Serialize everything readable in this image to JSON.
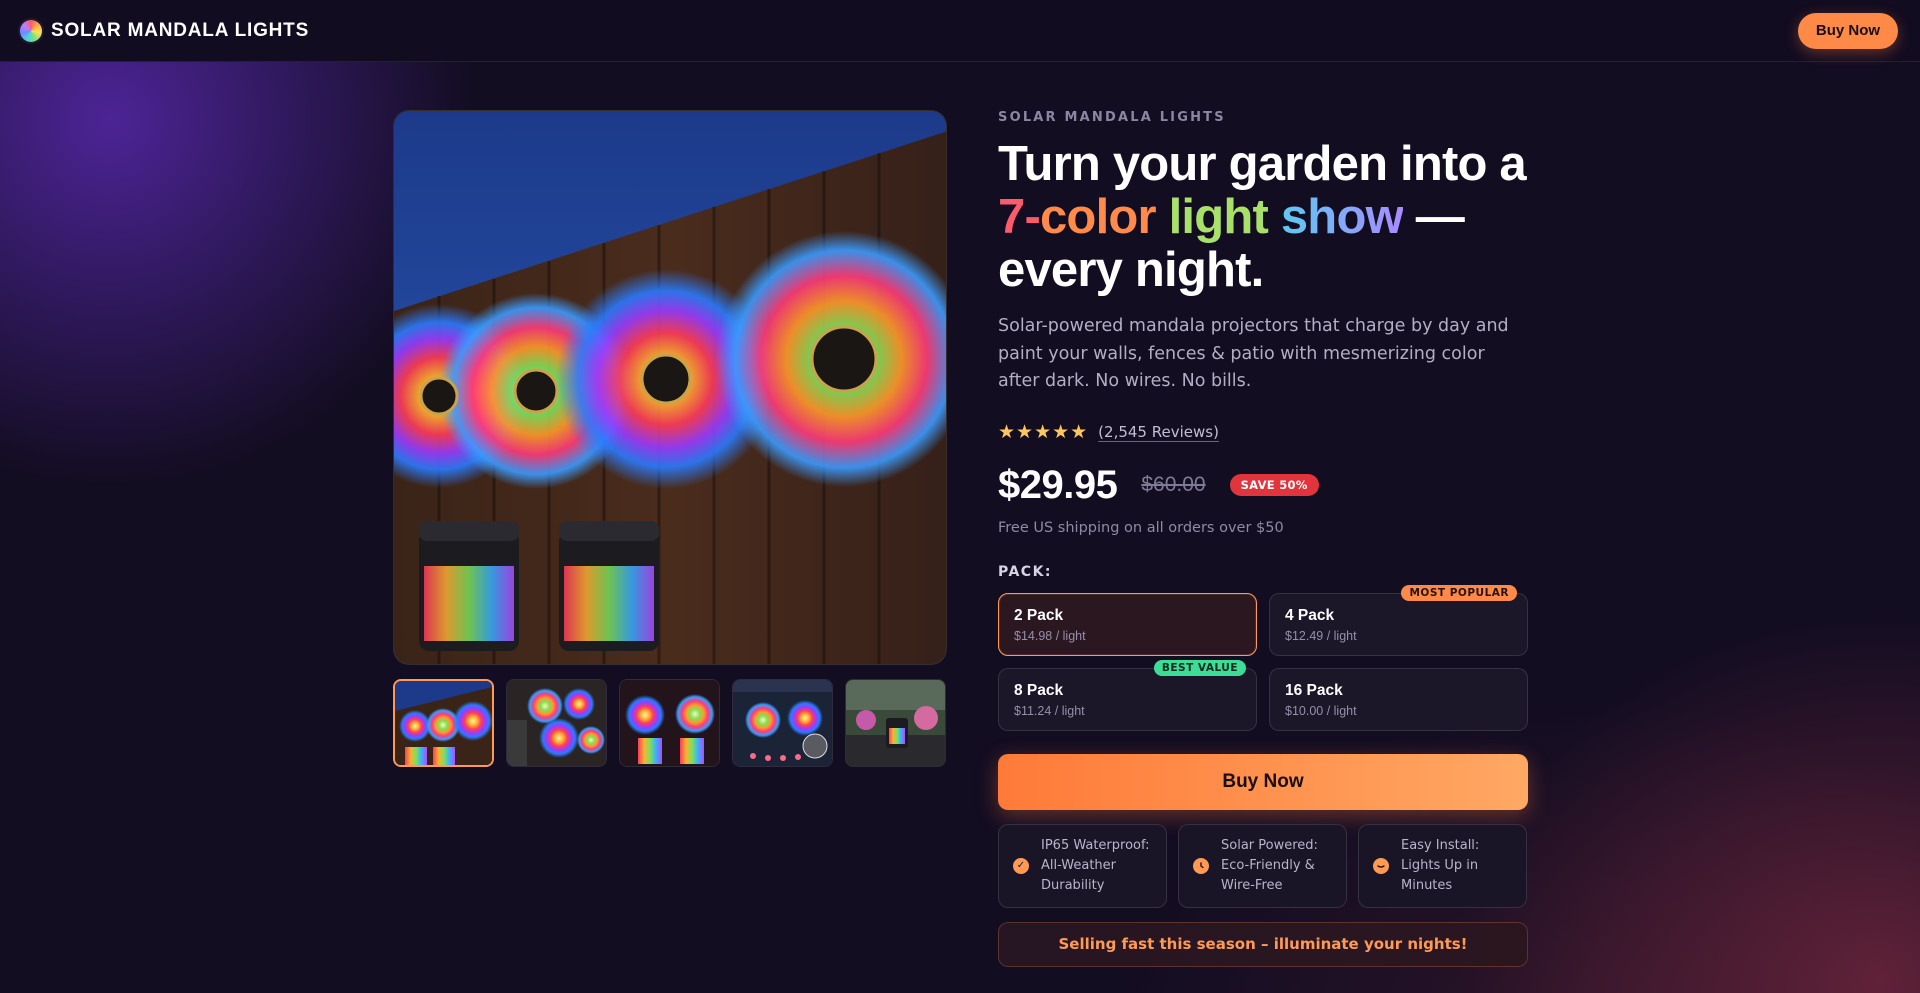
{
  "header": {
    "brand_name": "SOLAR MANDALA LIGHTS",
    "buy_label": "Buy Now"
  },
  "gallery": {
    "thumbnail_count": 5,
    "active_index": 0
  },
  "product": {
    "eyebrow": "SOLAR MANDALA LIGHTS",
    "headline_line1": "Turn your garden into a",
    "headline_words": [
      "7-",
      "color",
      "light",
      "show"
    ],
    "headline_dash": " —",
    "headline_line3": "every night.",
    "description": "Solar-powered mandala projectors that charge by day and paint your walls, fences & patio with mesmerizing color after dark. No wires. No bills.",
    "stars": "★★★★★",
    "rating": 5,
    "reviews": "(2,545 Reviews)",
    "price": "$29.95",
    "compare_price": "$60.00",
    "save_badge": "SAVE 50%",
    "shipping": "Free US shipping on all orders over $50"
  },
  "pack": {
    "label": "PACK:",
    "options": [
      {
        "name": "2 Pack",
        "per": "$14.98 / light",
        "tag": "",
        "selected": true
      },
      {
        "name": "4 Pack",
        "per": "$12.49 / light",
        "tag": "MOST POPULAR",
        "selected": false
      },
      {
        "name": "8 Pack",
        "per": "$11.24 / light",
        "tag": "BEST VALUE",
        "selected": false
      },
      {
        "name": "16 Pack",
        "per": "$10.00 / light",
        "tag": "",
        "selected": false
      }
    ]
  },
  "cta": {
    "buy_label": "Buy Now"
  },
  "features": [
    {
      "icon": "check-icon",
      "text": "IP65 Waterproof: All-Weather Durability"
    },
    {
      "icon": "clock-icon",
      "text": "Solar Powered: Eco-Friendly & Wire-Free"
    },
    {
      "icon": "wrench-icon",
      "text": "Easy Install: Lights Up in Minutes"
    }
  ],
  "urgency": "Selling fast this season – illuminate your nights!",
  "colors": {
    "accent": "#ff8a48",
    "background": "#130d22",
    "save_badge": "#e2343d",
    "best_value": "#3ddc97"
  }
}
